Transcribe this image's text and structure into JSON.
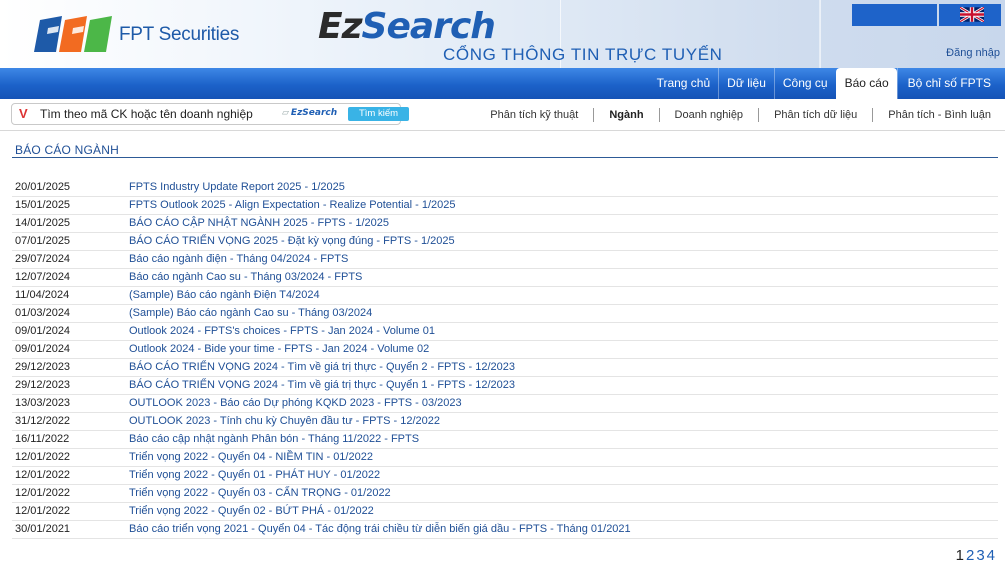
{
  "header": {
    "logo_text": "FPT Securities",
    "brand_part1": "Ez",
    "brand_part2": "Search",
    "portal_title": "CỔNG THÔNG TIN TRỰC TUYẾN",
    "login": "Đăng nhập",
    "language_icon": "uk-flag-icon"
  },
  "nav": {
    "items": [
      "Trang chủ",
      "Dữ liệu",
      "Công cụ",
      "Báo cáo",
      "Bộ chỉ số FPTS"
    ],
    "active": "Báo cáo"
  },
  "search": {
    "placeholder": "Tìm theo mã CK hoặc tên doanh nghiệp",
    "brand_small": "EzSearch",
    "button": "Tìm kiếm",
    "icon": "v-icon"
  },
  "subnav": {
    "items": [
      "Phân tích kỹ thuật",
      "Ngành",
      "Doanh nghiệp",
      "Phân tích dữ liệu",
      "Phân tích - Bình luận"
    ],
    "active": "Ngành"
  },
  "section": {
    "title": "BÁO CÁO NGÀNH"
  },
  "reports": [
    {
      "date": "20/01/2025",
      "title": "FPTS Industry Update Report 2025 - 1/2025"
    },
    {
      "date": "15/01/2025",
      "title": "FPTS Outlook 2025 - Align Expectation - Realize Potential - 1/2025"
    },
    {
      "date": "14/01/2025",
      "title": "BÁO CÁO CẬP NHẬT NGÀNH 2025 - FPTS - 1/2025"
    },
    {
      "date": "07/01/2025",
      "title": "BÁO CÁO TRIỂN VỌNG 2025 - Đặt kỳ vọng đúng - FPTS - 1/2025"
    },
    {
      "date": "29/07/2024",
      "title": "Báo cáo ngành điện - Tháng 04/2024 - FPTS"
    },
    {
      "date": "12/07/2024",
      "title": "Báo cáo ngành Cao su - Tháng 03/2024 - FPTS"
    },
    {
      "date": "11/04/2024",
      "title": "(Sample) Báo cáo ngành Điện T4/2024"
    },
    {
      "date": "01/03/2024",
      "title": "(Sample) Báo cáo ngành Cao su - Tháng 03/2024"
    },
    {
      "date": "09/01/2024",
      "title": "Outlook 2024 - FPTS's choices - FPTS - Jan 2024 - Volume 01"
    },
    {
      "date": "09/01/2024",
      "title": "Outlook 2024 - Bide your time - FPTS - Jan 2024 - Volume 02"
    },
    {
      "date": "29/12/2023",
      "title": "BÁO CÁO TRIỂN VỌNG 2024 - Tìm về giá trị thực - Quyển 2 - FPTS - 12/2023"
    },
    {
      "date": "29/12/2023",
      "title": "BÁO CÁO TRIỂN VỌNG 2024 - Tìm về giá trị thực - Quyển 1 - FPTS - 12/2023"
    },
    {
      "date": "13/03/2023",
      "title": "OUTLOOK 2023 - Báo cáo Dự phóng KQKD 2023 - FPTS - 03/2023"
    },
    {
      "date": "31/12/2022",
      "title": "OUTLOOK 2023 - Tính chu kỳ Chuyên đầu tư - FPTS - 12/2022"
    },
    {
      "date": "16/11/2022",
      "title": "Báo cáo cập nhật ngành Phân bón - Tháng 11/2022 - FPTS"
    },
    {
      "date": "12/01/2022",
      "title": "Triển vọng 2022 - Quyển 04 - NIỀM TIN - 01/2022"
    },
    {
      "date": "12/01/2022",
      "title": "Triển vọng 2022 - Quyển 01 - PHÁT HUY - 01/2022"
    },
    {
      "date": "12/01/2022",
      "title": "Triển vọng 2022 - Quyển 03 - CẨN TRỌNG - 01/2022"
    },
    {
      "date": "12/01/2022",
      "title": "Triển vọng 2022 - Quyển 02 - BỨT PHÁ - 01/2022"
    },
    {
      "date": "30/01/2021",
      "title": "Báo cáo triển vọng 2021 - Quyển 04 - Tác động trái chiều từ diễn biến giá dầu - FPTS - Tháng 01/2021"
    }
  ],
  "pager": {
    "pages": [
      "1",
      "2",
      "3",
      "4"
    ],
    "current": "1"
  },
  "colors": {
    "nav_blue": "#1c62c9",
    "link_blue": "#1f4f96",
    "logo_blue": "#1e5aa8",
    "logo_orange": "#f26b21",
    "logo_green": "#4cb748"
  }
}
